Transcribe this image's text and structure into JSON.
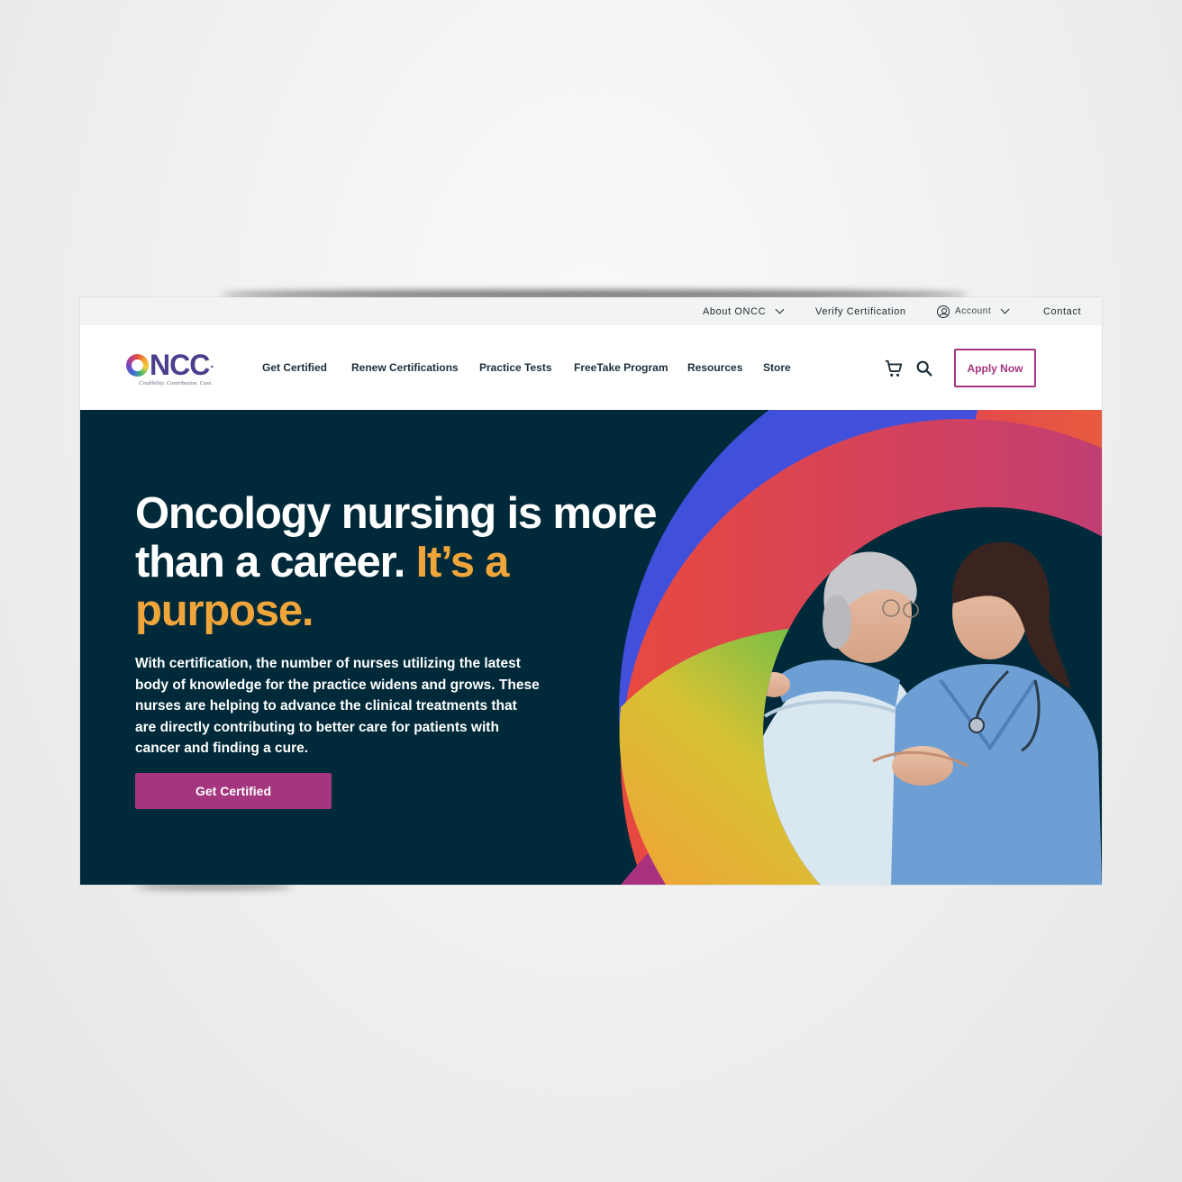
{
  "utility_bar": {
    "about": "About ONCC",
    "verify": "Verify Certification",
    "account": "Account",
    "contact": "Contact"
  },
  "logo": {
    "text": "NCC",
    "tagline": "Credibility. Contribution. Care."
  },
  "nav": {
    "items": [
      "Get Certified",
      "Renew Certifications",
      "Practice Tests",
      "FreeTake Program",
      "Resources",
      "Store"
    ],
    "apply_label": "Apply Now"
  },
  "icons": [
    "cart-icon",
    "search-icon",
    "account-icon",
    "chevron-down-icon"
  ],
  "hero": {
    "headline_white": "Oncology nursing is more than a career.",
    "headline_accent": "It’s a purpose.",
    "body": "With certification, the number of nurses utilizing the latest body of knowledge for the practice widens and grows. These nurses are helping to advance the clinical treatments that are directly contributing to better care for patients with cancer and finding a cure.",
    "cta_label": "Get Certified"
  },
  "colors": {
    "brand_magenta": "#a4357f",
    "hero_bg": "#002a3a",
    "accent_gold": "#f0a53a",
    "logo_purple": "#4a3f8c"
  }
}
